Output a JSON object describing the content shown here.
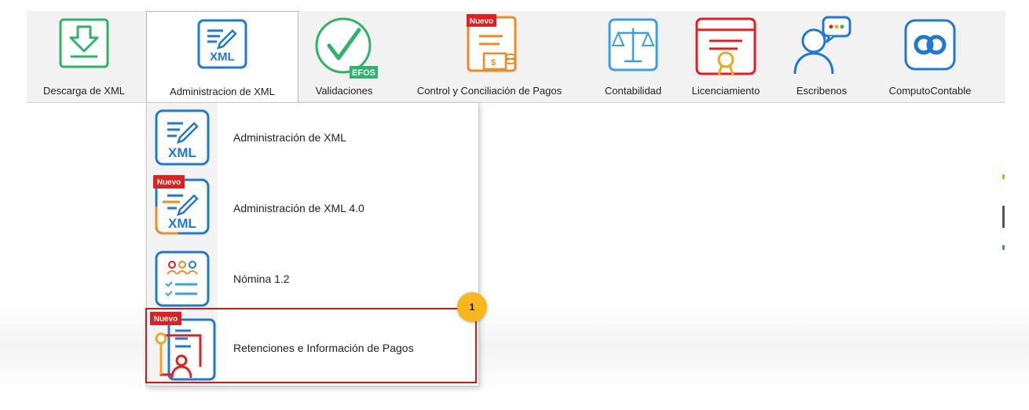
{
  "toolbar": {
    "items": [
      {
        "label": "Descarga de XML",
        "icon": "download-icon",
        "color": "#2fb36b"
      },
      {
        "label": "Administracion de XML",
        "icon": "xml-edit-icon",
        "color": "#1f78d1",
        "active": true
      },
      {
        "label": "Validaciones",
        "icon": "check-circle-icon",
        "color": "#2fb36b",
        "badge": "EFOS"
      },
      {
        "label": "Control y Conciliación de Pagos",
        "icon": "payments-doc-icon",
        "color": "#f08a24",
        "badge": "Nuevo"
      },
      {
        "label": "Contabilidad",
        "icon": "scales-icon",
        "color": "#3aa0e0"
      },
      {
        "label": "Licenciamiento",
        "icon": "certificate-icon",
        "color": "#e02020"
      },
      {
        "label": "Escribenos",
        "icon": "chat-user-icon",
        "color": "#1f78d1"
      },
      {
        "label": "ComputoContable",
        "icon": "logo-icon",
        "color": "#1f78d1"
      }
    ]
  },
  "dropdown": {
    "items": [
      {
        "label": "Administración de XML",
        "icon": "xml-edit-icon",
        "icon_text": "XML"
      },
      {
        "label": "Administración de XML 4.0",
        "icon": "xml-edit-icon",
        "icon_text": "XML",
        "badge": "Nuevo"
      },
      {
        "label": "Nómina 1.2",
        "icon": "payroll-icon"
      },
      {
        "label": "Retenciones e Información de Pagos",
        "icon": "retention-doc-icon",
        "badge": "Nuevo"
      }
    ]
  },
  "annotation": {
    "step": "1",
    "color": "#f6b81c",
    "highlight_color": "#d31818"
  }
}
